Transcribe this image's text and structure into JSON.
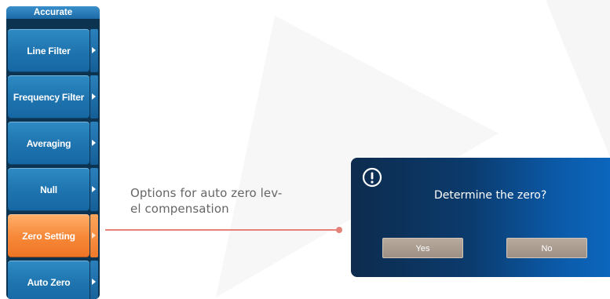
{
  "menu": {
    "header": "Accurate",
    "items": [
      {
        "label": "Line Filter"
      },
      {
        "label": "Frequency Filter"
      },
      {
        "label": "Averaging"
      },
      {
        "label": "Null"
      },
      {
        "label": "Zero Setting",
        "active": true
      },
      {
        "label": "Auto Zero"
      }
    ]
  },
  "callout": {
    "text_line1": "Options for auto zero lev-",
    "text_line2": "el compensation",
    "color": "#e5837a"
  },
  "dialog": {
    "icon": "exclamation-circle-icon",
    "message": "Determine the zero?",
    "yes_label": "Yes",
    "no_label": "No"
  },
  "colors": {
    "menu_button": "#1f75b0",
    "menu_active": "#f7893a",
    "dialog_bg": "#0b3a6c"
  }
}
